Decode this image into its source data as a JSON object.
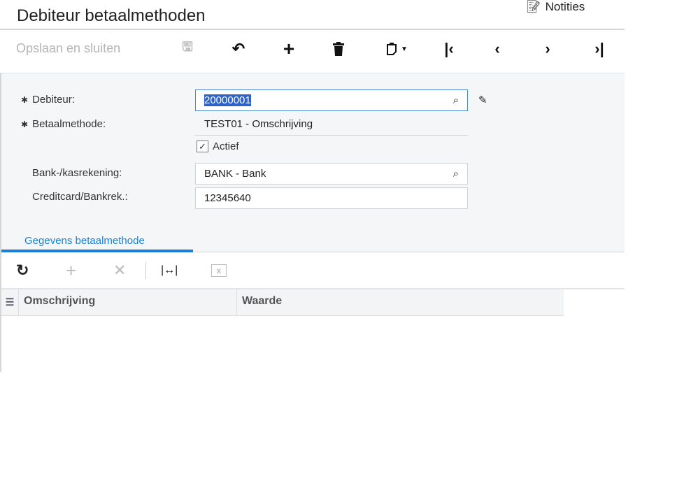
{
  "header": {
    "title": "Debiteur betaalmethoden",
    "notes_label": "Notities"
  },
  "toolbar": {
    "save_close_label": "Opslaan en sluiten"
  },
  "form": {
    "customer": {
      "label": "Debiteur:",
      "value": "20000001"
    },
    "payment_method": {
      "label": "Betaalmethode:",
      "value": "TEST01 - Omschrijving"
    },
    "active": {
      "label": "Actief",
      "checked": true
    },
    "cash_account": {
      "label": "Bank-/kasrekening:",
      "value": "BANK - Bank"
    },
    "card_account": {
      "label": "Creditcard/Bankrek.:",
      "value": "12345640"
    }
  },
  "tabs": [
    {
      "label": "Gegevens betaalmethode",
      "active": true
    }
  ],
  "grid": {
    "columns": [
      "Omschrijving",
      "Waarde"
    ],
    "rows": []
  }
}
